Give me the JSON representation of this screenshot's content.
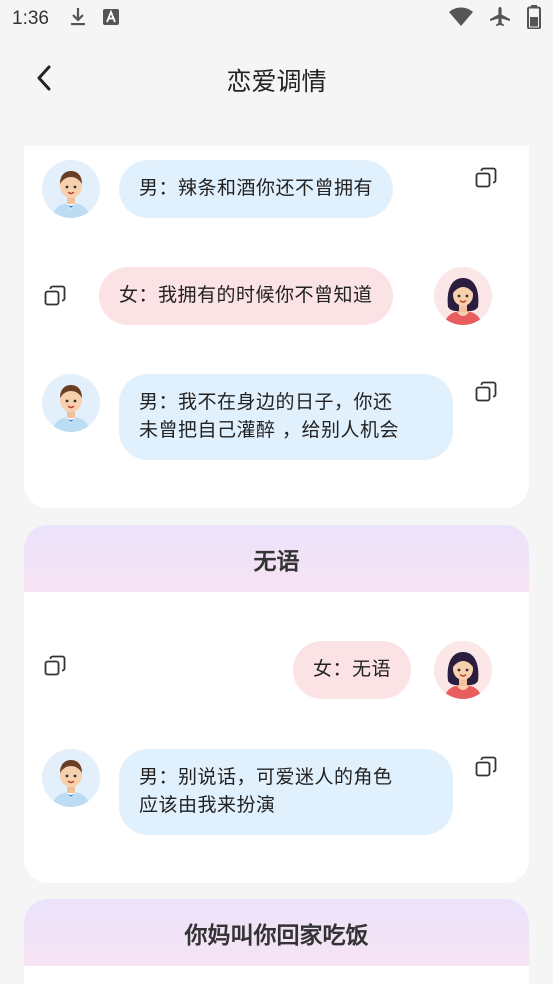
{
  "status_bar": {
    "time": "1:36",
    "left_icons": [
      "download-icon",
      "text-a-icon"
    ],
    "right_icons": [
      "wifi-icon",
      "airplane-mode-icon",
      "battery-icon"
    ]
  },
  "app_bar": {
    "back_icon": "back-arrow-icon",
    "title": "恋爱调情"
  },
  "card1": {
    "messages": [
      {
        "speaker": "male",
        "text": "男：辣条和酒你还不曾拥有"
      },
      {
        "speaker": "female",
        "text": "女：我拥有的时候你不曾知道"
      },
      {
        "speaker": "male",
        "line1": "男：我不在身边的日子，你还",
        "line2": "未曾把自己灌醉 ，给别人机会"
      }
    ]
  },
  "card2": {
    "title": "无语",
    "messages": [
      {
        "speaker": "female",
        "text": "女：无语"
      },
      {
        "speaker": "male",
        "line1": "男：别说话，可爱迷人的角色",
        "line2": "应该由我来扮演"
      }
    ]
  },
  "card3": {
    "title": "你妈叫你回家吃饭"
  },
  "colors": {
    "male_bubble": "#e1f0fd",
    "female_bubble": "#fbe2e5",
    "header_gradient_top": "#ebe3fb",
    "header_gradient_bottom": "#f6e3f3",
    "background": "#f5f5f5"
  }
}
